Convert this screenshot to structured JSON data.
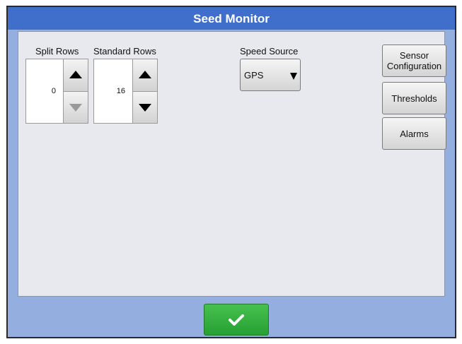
{
  "window": {
    "title": "Seed Monitor"
  },
  "split_rows": {
    "label": "Split Rows",
    "value": "0",
    "up_icon": "arrow-up-icon",
    "down_icon": "arrow-down-icon",
    "down_enabled": false
  },
  "standard_rows": {
    "label": "Standard Rows",
    "value": "16",
    "up_icon": "arrow-up-icon",
    "down_icon": "arrow-down-icon",
    "down_enabled": true
  },
  "speed_source": {
    "label": "Speed Source",
    "selected": "GPS",
    "icon": "dropdown-arrow-icon"
  },
  "side_buttons": {
    "sensor_configuration": "Sensor Configuration",
    "thresholds": "Thresholds",
    "alarms": "Alarms"
  },
  "footer": {
    "ok_icon": "checkmark-icon"
  },
  "colors": {
    "title_bar": "#3f6fcb",
    "footer": "#95aee0",
    "content": "#e8e9ef",
    "ok_button": "#2fae3a"
  }
}
